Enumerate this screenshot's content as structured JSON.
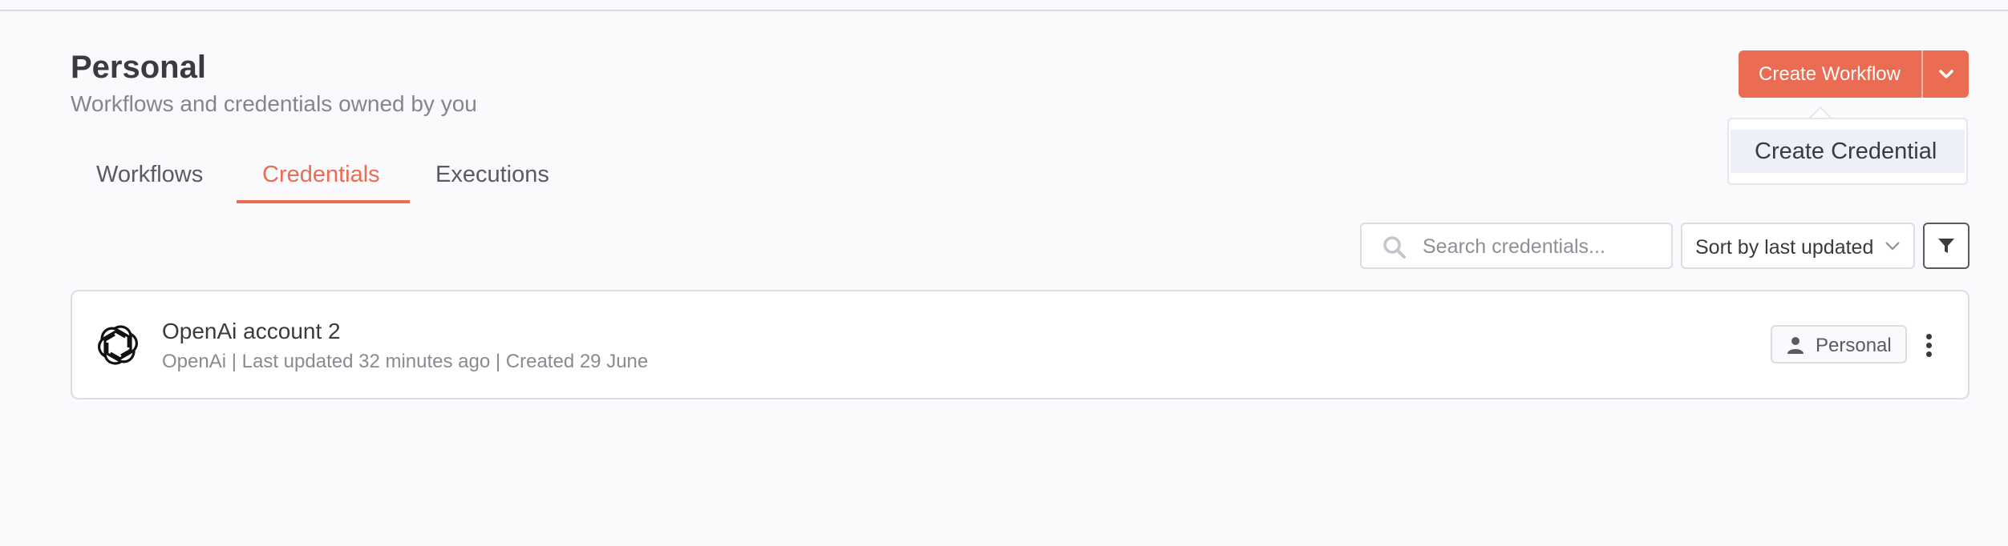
{
  "header": {
    "title": "Personal",
    "subtitle": "Workflows and credentials owned by you"
  },
  "tabs": [
    {
      "label": "Workflows",
      "active": false
    },
    {
      "label": "Credentials",
      "active": true
    },
    {
      "label": "Executions",
      "active": false
    }
  ],
  "actions": {
    "create_workflow_label": "Create Workflow",
    "dropdown_items": [
      "Create Credential"
    ]
  },
  "toolbar": {
    "search_placeholder": "Search credentials...",
    "search_value": "",
    "sort_label": "Sort by last updated",
    "filter_icon": "filter-icon"
  },
  "credentials": [
    {
      "name": "OpenAi account 2",
      "type": "OpenAi",
      "last_updated": "Last updated 32 minutes ago",
      "created": "Created 29 June",
      "owner": "Personal",
      "icon": "openai-logo-icon"
    }
  ],
  "colors": {
    "accent": "#ea6c53",
    "background": "#fafafc",
    "border": "#dcdce3"
  }
}
